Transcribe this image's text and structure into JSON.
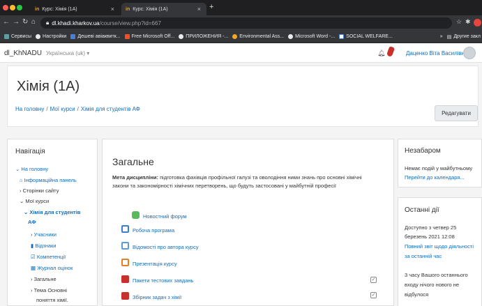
{
  "browser": {
    "tabs": [
      {
        "favicon": "in",
        "title": "Курс: Хімія (1А)"
      },
      {
        "favicon": "in",
        "title": "Курс: Хімія (1А)"
      }
    ],
    "new_tab_symbol": "+",
    "url_host": "dl.khadi.kharkov.ua",
    "url_path": "/course/view.php?id=667",
    "bookmarks": [
      {
        "label": "Сервисы",
        "color": "#5f9ea0"
      },
      {
        "label": "Настройки",
        "color": "#e8eaed"
      },
      {
        "label": "Дешеві авіаквитк...",
        "color": "#4a7fd8"
      },
      {
        "label": "Free Microsoft Off...",
        "color": "#f25022"
      },
      {
        "label": "ПРИЛОЖЕНИЯ -...",
        "color": "#e8eaed"
      },
      {
        "label": "Environmental Ass...",
        "color": "#f5a623"
      },
      {
        "label": "Microsoft Word -...",
        "color": "#e8eaed"
      },
      {
        "label": "SOCIAL WELFARE...",
        "color": "#ffffff"
      }
    ],
    "other_bookmarks": "Другие закл"
  },
  "navbar": {
    "site_name": "dl_KhNADU",
    "language": "Українська (uk)",
    "user_name": "Даценко Віта Василівна"
  },
  "page": {
    "title": "Хімія (1А)",
    "breadcrumb": [
      "На головну",
      "Мої курси",
      "Хімія для студентів АФ"
    ],
    "edit_button": "Редагувати"
  },
  "navigation": {
    "title": "Навігація",
    "items": [
      {
        "label": "На головну",
        "prefix": "⌄"
      },
      {
        "label": "Інформаційна панель",
        "prefix": "⌂"
      },
      {
        "label": "Сторінки сайту",
        "prefix": "›"
      },
      {
        "label": "Мої курси",
        "prefix": "⌄"
      },
      {
        "label": "Хімія для студентів",
        "prefix": "⌄"
      },
      {
        "label": "АФ",
        "prefix": ""
      },
      {
        "label": "Учасники",
        "prefix": "›"
      },
      {
        "label": "Відзнаки",
        "prefix": "▮"
      },
      {
        "label": "Компетенції",
        "prefix": "☑"
      },
      {
        "label": "Журнал оцінок",
        "prefix": "▦"
      },
      {
        "label": "Загальне",
        "prefix": "›"
      },
      {
        "label": "Тема Основні",
        "prefix": "›"
      },
      {
        "label": "поняття хімії.",
        "prefix": ""
      }
    ]
  },
  "section": {
    "title": "Загальне",
    "summary_label": "Мета дисципліни:",
    "summary_line1": " підготовка фахівців профільної галузі та оволодіння ними знань про основні хімічні",
    "summary_line2": "закони та закономірності хімічних перетворень, що будуть застосовані у майбутній професії",
    "activities": [
      {
        "label": "Новостний форум",
        "icon": "forum-icon",
        "color": "#5cb85c"
      },
      {
        "label": "Робоча програма",
        "icon": "document-icon",
        "color": "#3a7bd5"
      },
      {
        "label": "Відомості про автора курсу",
        "icon": "page-icon",
        "color": "#5b9bd5"
      },
      {
        "label": "Презентація курсу",
        "icon": "presentation-icon",
        "color": "#e67e22"
      },
      {
        "label": "Пакети тестових завдань",
        "icon": "pdf-icon",
        "color": "#c9302c"
      },
      {
        "label": "Збірник задач з хімії",
        "icon": "pdf-icon",
        "color": "#c9302c"
      }
    ],
    "check_symbol": "✓"
  },
  "upcoming": {
    "title": "Незабаром",
    "text": "Немає подій у майбутньому",
    "link": "Перейти до календаря..."
  },
  "recent": {
    "title": "Останні дії",
    "since_line1": "Доступно з четвер 25",
    "since_line2": "березень 2021 12:08",
    "report_line1": "Повний звіт щодо діяльності",
    "report_line2": "за останній час",
    "note_line1": "3 часу Вашого останнього",
    "note_line2": "входу нічого нового не",
    "note_line3": "відбулося"
  }
}
